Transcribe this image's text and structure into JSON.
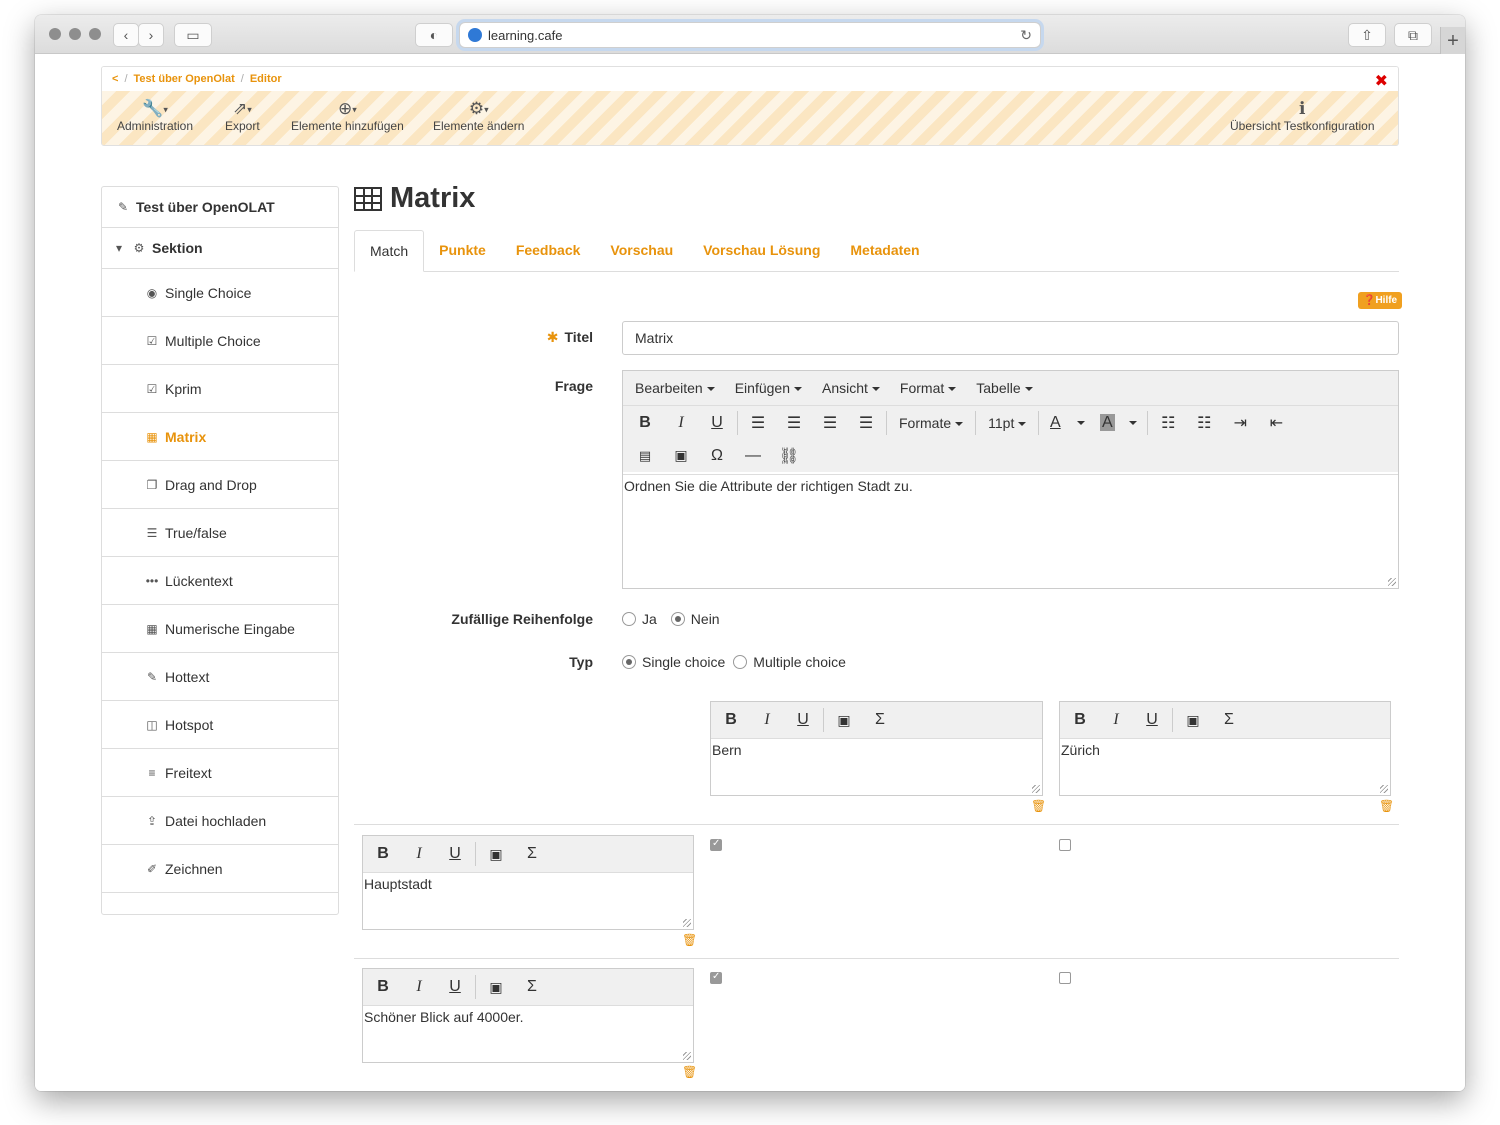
{
  "browser": {
    "url": "learning.cafe"
  },
  "breadcrumb": {
    "back": "<",
    "course": "Test über OpenOlat",
    "current": "Editor",
    "close": "✖"
  },
  "toolbar": {
    "administration": "Administration",
    "export": "Export",
    "add_elements": "Elemente hinzufügen",
    "change_elements": "Elemente ändern",
    "test_overview": "Übersicht Testkonfiguration"
  },
  "tree": {
    "root": "Test über OpenOLAT",
    "section": "Sektion",
    "items": [
      {
        "label": "Single Choice",
        "icon": "◉"
      },
      {
        "label": "Multiple Choice",
        "icon": "☑"
      },
      {
        "label": "Kprim",
        "icon": "☑"
      },
      {
        "label": "Matrix",
        "icon": "▦"
      },
      {
        "label": "Drag and Drop",
        "icon": "❐"
      },
      {
        "label": "True/false",
        "icon": "☰"
      },
      {
        "label": "Lückentext",
        "icon": "•••"
      },
      {
        "label": "Numerische Eingabe",
        "icon": "▦"
      },
      {
        "label": "Hottext",
        "icon": "✎"
      },
      {
        "label": "Hotspot",
        "icon": "◫"
      },
      {
        "label": "Freitext",
        "icon": "≡"
      },
      {
        "label": "Datei hochladen",
        "icon": "⇪"
      },
      {
        "label": "Zeichnen",
        "icon": "✐"
      }
    ]
  },
  "main": {
    "title": "Matrix",
    "tabs": [
      "Match",
      "Punkte",
      "Feedback",
      "Vorschau",
      "Vorschau Lösung",
      "Metadaten"
    ],
    "help": "❓Hilfe",
    "title_label": "Titel",
    "title_value": "Matrix",
    "question_label": "Frage",
    "menus": [
      "Bearbeiten",
      "Einfügen",
      "Ansicht",
      "Format",
      "Tabelle"
    ],
    "format_dropdown": "Formate",
    "size_dropdown": "11pt",
    "question_text": "Ordnen Sie die Attribute der richtigen Stadt zu.",
    "random_label": "Zufällige Reihenfolge",
    "random_yes": "Ja",
    "random_no": "Nein",
    "type_label": "Typ",
    "type_single": "Single choice",
    "type_multiple": "Multiple choice",
    "columns": [
      "Bern",
      "Zürich"
    ],
    "rows": [
      "Hauptstadt",
      "Schöner Blick auf 4000er."
    ]
  }
}
